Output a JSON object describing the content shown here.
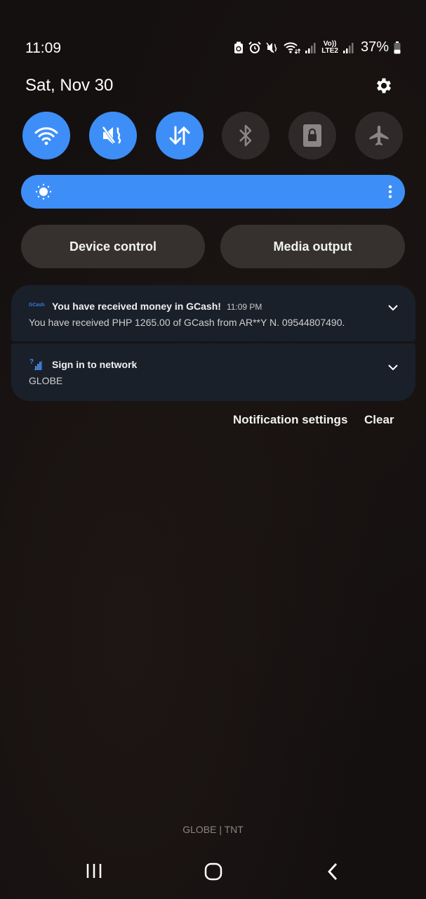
{
  "status_bar": {
    "time": "11:09",
    "battery_percent": "37%",
    "battery_level": 0.37,
    "icons": [
      "battery-saver-icon",
      "alarm-icon",
      "mute-icon",
      "wifi-data-icon",
      "signal-icon",
      "volte-lte2-icon",
      "signal-icon",
      "battery-icon"
    ],
    "volte_label_top": "Vo))",
    "volte_label_bottom": "LTE2"
  },
  "header": {
    "date": "Sat, Nov 30",
    "settings_icon": "gear-icon"
  },
  "quick_toggles": [
    {
      "name": "wifi",
      "icon": "wifi-icon",
      "state": "on"
    },
    {
      "name": "mute",
      "icon": "mute-icon",
      "state": "on"
    },
    {
      "name": "mobile-data",
      "icon": "data-arrows-icon",
      "state": "on"
    },
    {
      "name": "bluetooth",
      "icon": "bluetooth-icon",
      "state": "off"
    },
    {
      "name": "secure-folder",
      "icon": "lock-icon",
      "state": "off"
    },
    {
      "name": "airplane-mode",
      "icon": "airplane-icon",
      "state": "off"
    }
  ],
  "brightness": {
    "level": 1.0,
    "icon": "sun-icon",
    "more_icon": "more-vertical-icon"
  },
  "buttons": {
    "device_control": "Device control",
    "media_output": "Media output"
  },
  "notifications": [
    {
      "app": "GCash",
      "title": "You have received money in GCash!",
      "time": "11:09 PM",
      "body": "You have received PHP 1265.00 of GCash from AR**Y N. 09544807490."
    },
    {
      "title": "Sign in to network",
      "body": "GLOBE"
    }
  ],
  "actions": {
    "notification_settings": "Notification settings",
    "clear": "Clear"
  },
  "carrier": "GLOBE | TNT",
  "colors": {
    "accent": "#3e8ef7",
    "toggle_off": "#2f2a29",
    "card": "#19202a"
  }
}
